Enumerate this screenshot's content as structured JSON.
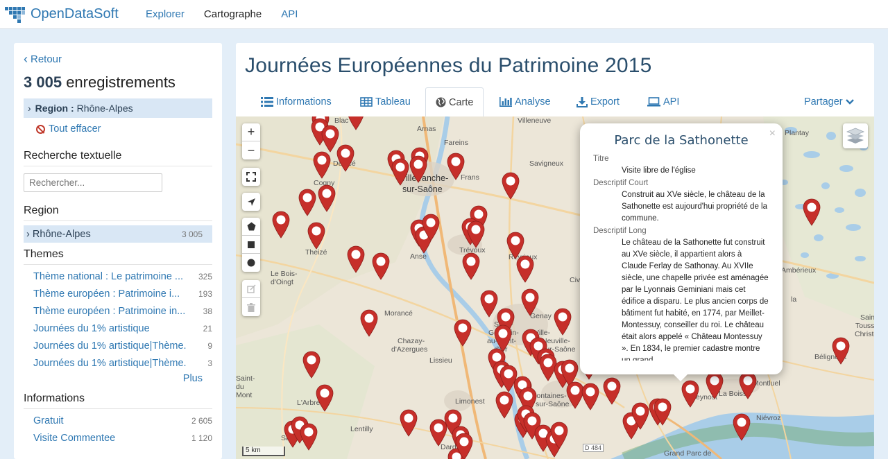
{
  "brand": {
    "name": "OpenDataSoft",
    "color": "#2f78b2"
  },
  "nav": {
    "items": [
      "Explorer",
      "Cartographe",
      "API"
    ]
  },
  "sidebar": {
    "back_label": "Retour",
    "records_count": "3 005",
    "records_label": "enregistrements",
    "active_filter": {
      "field": "Region :",
      "value": "Rhône-Alpes"
    },
    "clear_all": "Tout effacer",
    "search": {
      "title": "Recherche textuelle",
      "placeholder": "Rechercher..."
    },
    "region": {
      "title": "Region",
      "items": [
        {
          "label": "Rhône-Alpes",
          "count": "3 005",
          "selected": true
        }
      ]
    },
    "themes": {
      "title": "Themes",
      "items": [
        {
          "label": "Thème national : Le patrimoine ...",
          "count": "325"
        },
        {
          "label": "Thème européen : Patrimoine i...",
          "count": "193"
        },
        {
          "label": "Thème européen : Patrimoine in...",
          "count": "38"
        },
        {
          "label": "Journées du 1% artistique",
          "count": "21"
        },
        {
          "label": "Journées du 1% artistique|Thème...",
          "count": "9"
        },
        {
          "label": "Journées du 1% artistique|Thème...",
          "count": "3"
        }
      ],
      "more": "Plus"
    },
    "informations": {
      "title": "Informations",
      "items": [
        {
          "label": "Gratuit",
          "count": "2 605"
        },
        {
          "label": "Visite Commentee",
          "count": "1 120"
        }
      ]
    }
  },
  "main": {
    "title": "Journées Européennes du Patrimoine 2015",
    "tabs": [
      {
        "label": "Informations",
        "icon": "list-icon"
      },
      {
        "label": "Tableau",
        "icon": "table-icon"
      },
      {
        "label": "Carte",
        "icon": "globe-icon",
        "active": true
      },
      {
        "label": "Analyse",
        "icon": "chart-icon"
      },
      {
        "label": "Export",
        "icon": "download-icon"
      },
      {
        "label": "API",
        "icon": "laptop-icon"
      }
    ],
    "share_label": "Partager"
  },
  "map": {
    "scale_label": "5 km",
    "marker_color": "#c62f2a",
    "place_labels": [
      "Villefranche-",
      "sur-Saône",
      "Fareins",
      "Villeneuve",
      "Savigneux",
      "Frans",
      "Arnas",
      "Cogny",
      "Theizé",
      "Le Bois-",
      "d'Oingt",
      "Anse",
      "Trévoux",
      "Reyrieux",
      "Civ",
      "Morancé",
      "Chazay-",
      "d'Azergues",
      "Lissieu",
      "Limonest",
      "Fontaines-",
      "sur-Saône",
      "L'Arbre",
      "Lentilly",
      "Saint-Bel",
      "Dardilly",
      "Beynost",
      "La Boisse",
      "Montluel",
      "Niévroz",
      "Béligneux",
      "Plantay",
      "D 484",
      "Grand Parc de",
      "Blac",
      "Denicé",
      "Saint-",
      "Germain-",
      "au-Mont-",
      "d'Or",
      "Neuville-",
      "sur-Saône",
      "Genay",
      "Saint-",
      "Saint-",
      "Christe",
      "Ambérieux",
      "du",
      "Toussieux",
      "Mont",
      "Ville-",
      "la"
    ]
  },
  "popup": {
    "title": "Parc de la Sathonette",
    "fields": [
      {
        "label": "Titre",
        "value": "Visite libre de l'église"
      },
      {
        "label": "Descriptif Court",
        "value": "Construit au XVe siècle, le château de la Sathonette est aujourd'hui propriété de la commune."
      },
      {
        "label": "Descriptif Long",
        "value": "Le château de la Sathonette fut construit au XVe siècle, il appartient alors à Claude Ferlay de Sathonay. Au XVIIe siècle, une chapelle privée est aménagée par le Lyonnais Geminiani mais cet édifice a disparu. Le plus ancien corps de bâtiment fut habité, en 1774, par Meillet-Montessuy, conseiller du roi. Le château était alors appelé « Château Montessuy ».  En 1834, le premier cadastre montre un grand"
      }
    ]
  }
}
